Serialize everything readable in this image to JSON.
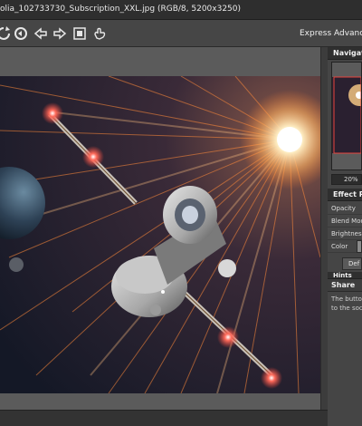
{
  "window": {
    "title": "olia_102733730_Subscription_XXL.jpg (RGB/8, 5200x3250)"
  },
  "toolbar": {
    "icons": [
      "rotate-icon",
      "undo-icon",
      "back-arrow-icon",
      "forward-arrow-icon",
      "fit-screen-icon",
      "hand-cursor-icon"
    ],
    "modes": {
      "express": "Express",
      "advanced": "Advanc"
    }
  },
  "navigator": {
    "title": "Navigator",
    "zoom": "20%"
  },
  "effects": {
    "title": "Effect Pan",
    "rows": [
      "Opacity",
      "Blend Mode",
      "Brightness",
      "Color"
    ],
    "default_button": "Def"
  },
  "hints": {
    "title": "Hints",
    "share_label": "Share",
    "lines": [
      "The button S",
      "to the social"
    ]
  },
  "colors": {
    "accent_glow": "#ffbe6a",
    "ray": "#ff7a2a",
    "light": "#e8453c"
  }
}
